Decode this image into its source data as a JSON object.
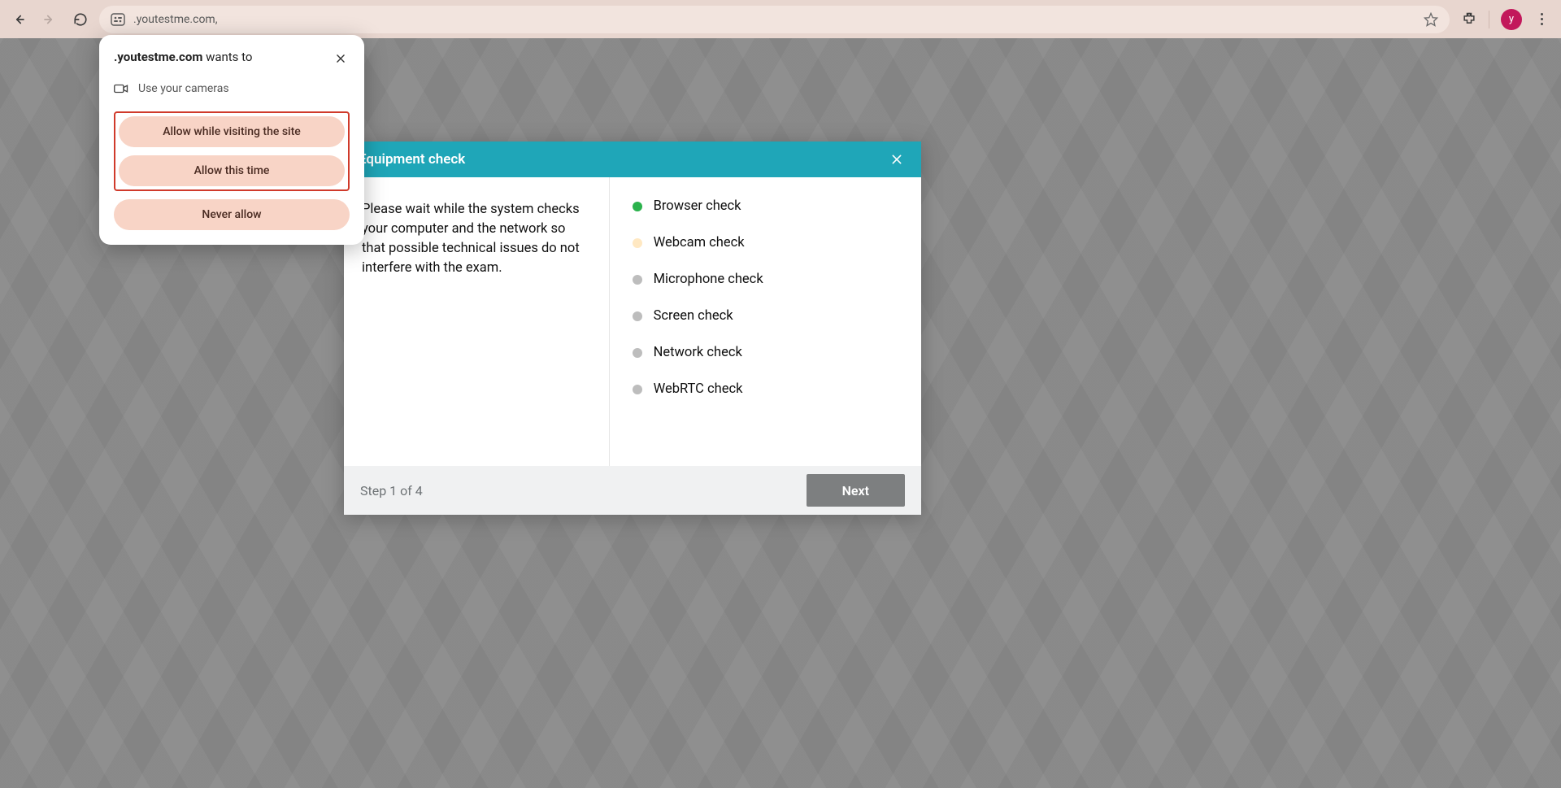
{
  "browser": {
    "url": ".youtestme.com,",
    "avatar_letter": "y"
  },
  "permission": {
    "domain": ".youtestme.com",
    "wants_to": " wants to",
    "request": "Use your cameras",
    "allow_visiting": "Allow while visiting the site",
    "allow_once": "Allow this time",
    "never": "Never allow"
  },
  "modal": {
    "title": "Equipment check",
    "description": "Please wait while the system checks your computer and the network so that possible technical issues do not interfere with the exam.",
    "checks": [
      {
        "label": "Browser check",
        "status": "green"
      },
      {
        "label": "Webcam check",
        "status": "cream"
      },
      {
        "label": "Microphone check",
        "status": "grey"
      },
      {
        "label": "Screen check",
        "status": "grey"
      },
      {
        "label": "Network check",
        "status": "grey"
      },
      {
        "label": "WebRTC check",
        "status": "grey"
      }
    ],
    "step_label": "Step 1 of 4",
    "next_label": "Next"
  }
}
